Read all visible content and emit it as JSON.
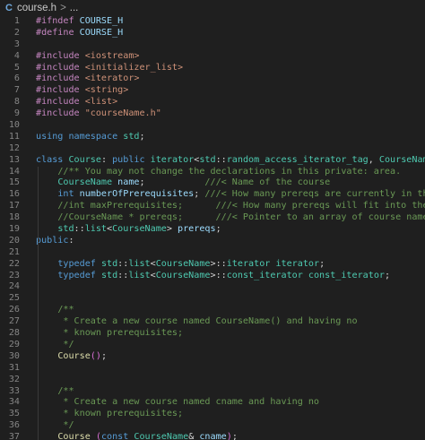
{
  "breadcrumb": {
    "file_icon": "C",
    "file": "course.h",
    "separator": ">",
    "more": "..."
  },
  "colors": {
    "background": "#1f1f1f",
    "line_number": "#858585",
    "keyword": "#569cd6",
    "preprocessor": "#c586c0",
    "string": "#ce9178",
    "type": "#4ec9b0",
    "function": "#dcdcaa",
    "variable": "#9cdcfe",
    "comment": "#6a9955"
  },
  "lines": [
    {
      "n": "1",
      "tokens": [
        [
          "pp",
          "#ifndef "
        ],
        [
          "var",
          "COURSE_H"
        ]
      ]
    },
    {
      "n": "2",
      "tokens": [
        [
          "pp",
          "#define "
        ],
        [
          "var",
          "COURSE_H"
        ]
      ]
    },
    {
      "n": "3",
      "tokens": []
    },
    {
      "n": "4",
      "tokens": [
        [
          "pp",
          "#include "
        ],
        [
          "str",
          "<iostream>"
        ]
      ]
    },
    {
      "n": "5",
      "tokens": [
        [
          "pp",
          "#include "
        ],
        [
          "str",
          "<initializer_list>"
        ]
      ]
    },
    {
      "n": "6",
      "tokens": [
        [
          "pp",
          "#include "
        ],
        [
          "str",
          "<iterator>"
        ]
      ]
    },
    {
      "n": "7",
      "tokens": [
        [
          "pp",
          "#include "
        ],
        [
          "str",
          "<string>"
        ]
      ]
    },
    {
      "n": "8",
      "tokens": [
        [
          "pp",
          "#include "
        ],
        [
          "str",
          "<list>"
        ]
      ]
    },
    {
      "n": "9",
      "tokens": [
        [
          "pp",
          "#include "
        ],
        [
          "str",
          "\"courseName.h\""
        ]
      ]
    },
    {
      "n": "10",
      "tokens": []
    },
    {
      "n": "11",
      "tokens": [
        [
          "kw",
          "using "
        ],
        [
          "kw",
          "namespace "
        ],
        [
          "ns",
          "std"
        ],
        [
          "op",
          ";"
        ]
      ]
    },
    {
      "n": "12",
      "tokens": []
    },
    {
      "n": "13",
      "tokens": [
        [
          "kw",
          "class "
        ],
        [
          "ty",
          "Course"
        ],
        [
          "op",
          ": "
        ],
        [
          "kw",
          "public "
        ],
        [
          "ty",
          "iterator"
        ],
        [
          "op",
          "<"
        ],
        [
          "ns",
          "std"
        ],
        [
          "op",
          "::"
        ],
        [
          "ty",
          "random_access_iterator_tag"
        ],
        [
          "op",
          ", "
        ],
        [
          "ty",
          "CourseName"
        ],
        [
          "op",
          "> "
        ],
        [
          "br",
          "{"
        ]
      ]
    },
    {
      "n": "14",
      "tokens": [
        [
          "op",
          "    "
        ],
        [
          "cm",
          "//** You may not change the declarations in this private: area."
        ]
      ]
    },
    {
      "n": "15",
      "tokens": [
        [
          "op",
          "    "
        ],
        [
          "ty",
          "CourseName "
        ],
        [
          "var",
          "name"
        ],
        [
          "op",
          ";           "
        ],
        [
          "cm",
          "///< Name of the course"
        ]
      ]
    },
    {
      "n": "16",
      "tokens": [
        [
          "op",
          "    "
        ],
        [
          "kw",
          "int "
        ],
        [
          "var",
          "numberOfPrerequisites"
        ],
        [
          "op",
          "; "
        ],
        [
          "cm",
          "///< How many prereqs are currently in the array?"
        ]
      ]
    },
    {
      "n": "17",
      "tokens": [
        [
          "op",
          "    "
        ],
        [
          "cm",
          "//int maxPrerequisites;      ///< How many prereqs will fit into the array?"
        ]
      ]
    },
    {
      "n": "18",
      "tokens": [
        [
          "op",
          "    "
        ],
        [
          "cm",
          "//CourseName * prereqs;      ///< Pointer to an array of course names."
        ]
      ]
    },
    {
      "n": "19",
      "tokens": [
        [
          "op",
          "    "
        ],
        [
          "ns",
          "std"
        ],
        [
          "op",
          "::"
        ],
        [
          "ty",
          "list"
        ],
        [
          "op",
          "<"
        ],
        [
          "ty",
          "CourseName"
        ],
        [
          "op",
          "> "
        ],
        [
          "var",
          "prereqs"
        ],
        [
          "op",
          ";"
        ]
      ]
    },
    {
      "n": "20",
      "tokens": [
        [
          "kw",
          "public"
        ],
        [
          "op",
          ":"
        ]
      ]
    },
    {
      "n": "21",
      "tokens": []
    },
    {
      "n": "22",
      "tokens": [
        [
          "op",
          "    "
        ],
        [
          "kw",
          "typedef "
        ],
        [
          "ns",
          "std"
        ],
        [
          "op",
          "::"
        ],
        [
          "ty",
          "list"
        ],
        [
          "op",
          "<"
        ],
        [
          "ty",
          "CourseName"
        ],
        [
          "op",
          ">::"
        ],
        [
          "ty",
          "iterator "
        ],
        [
          "ty",
          "iterator"
        ],
        [
          "op",
          ";"
        ]
      ]
    },
    {
      "n": "23",
      "tokens": [
        [
          "op",
          "    "
        ],
        [
          "kw",
          "typedef "
        ],
        [
          "ns",
          "std"
        ],
        [
          "op",
          "::"
        ],
        [
          "ty",
          "list"
        ],
        [
          "op",
          "<"
        ],
        [
          "ty",
          "CourseName"
        ],
        [
          "op",
          ">::"
        ],
        [
          "ty",
          "const_iterator "
        ],
        [
          "ty",
          "const_iterator"
        ],
        [
          "op",
          ";"
        ]
      ]
    },
    {
      "n": "24",
      "tokens": []
    },
    {
      "n": "25",
      "tokens": []
    },
    {
      "n": "26",
      "tokens": [
        [
          "op",
          "    "
        ],
        [
          "cm",
          "/**"
        ]
      ]
    },
    {
      "n": "27",
      "tokens": [
        [
          "op",
          "    "
        ],
        [
          "cm",
          " * Create a new course named CourseName() and having no"
        ]
      ]
    },
    {
      "n": "28",
      "tokens": [
        [
          "op",
          "    "
        ],
        [
          "cm",
          " * known prerequisites;"
        ]
      ]
    },
    {
      "n": "29",
      "tokens": [
        [
          "op",
          "    "
        ],
        [
          "cm",
          " */"
        ]
      ]
    },
    {
      "n": "30",
      "tokens": [
        [
          "op",
          "    "
        ],
        [
          "fn",
          "Course"
        ],
        [
          "brp",
          "()"
        ],
        [
          "op",
          ";"
        ]
      ]
    },
    {
      "n": "31",
      "tokens": []
    },
    {
      "n": "32",
      "tokens": []
    },
    {
      "n": "33",
      "tokens": [
        [
          "op",
          "    "
        ],
        [
          "cm",
          "/**"
        ]
      ]
    },
    {
      "n": "34",
      "tokens": [
        [
          "op",
          "    "
        ],
        [
          "cm",
          " * Create a new course named cname and having no"
        ]
      ]
    },
    {
      "n": "35",
      "tokens": [
        [
          "op",
          "    "
        ],
        [
          "cm",
          " * known prerequisites;"
        ]
      ]
    },
    {
      "n": "36",
      "tokens": [
        [
          "op",
          "    "
        ],
        [
          "cm",
          " */"
        ]
      ]
    },
    {
      "n": "37",
      "tokens": [
        [
          "op",
          "    "
        ],
        [
          "fn",
          "Course "
        ],
        [
          "brp",
          "("
        ],
        [
          "kw",
          "const "
        ],
        [
          "ty",
          "CourseName"
        ],
        [
          "op",
          "& "
        ],
        [
          "var",
          "cname"
        ],
        [
          "brp",
          ")"
        ],
        [
          "op",
          ";"
        ]
      ]
    }
  ]
}
